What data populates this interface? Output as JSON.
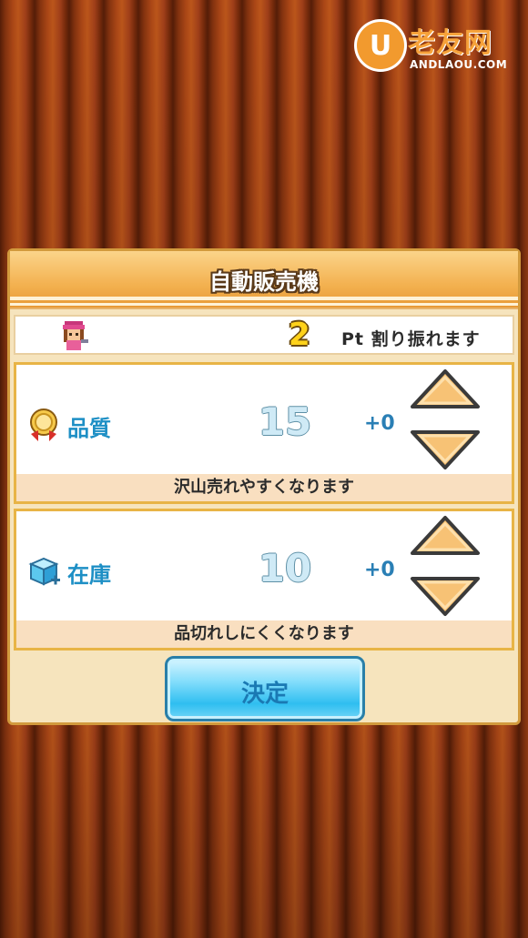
{
  "watermark": {
    "logo_letter": "U",
    "site_name": "老友网",
    "site_url": "ANDLAOU.COM"
  },
  "dialog": {
    "title": "自動販売機",
    "points": {
      "value": "2",
      "label": "Pt 割り振れます"
    },
    "stats": [
      {
        "icon": "gold-medal-icon",
        "label": "品質",
        "value": "15",
        "bonus": "+0",
        "description": "沢山売れやすくなります"
      },
      {
        "icon": "ice-cube-box-icon",
        "label": "在庫",
        "value": "10",
        "bonus": "+0",
        "description": "品切れしにくくなります"
      }
    ],
    "confirm_label": "決定"
  },
  "colors": {
    "curtain": "#a8421a",
    "dialog_bg": "#f6e4bd",
    "header": "#f3b150",
    "stat_label": "#1d8fc5",
    "points_number": "#ffd21a",
    "arrow_fill": "#f7c275",
    "confirm_button": "#2fbef0"
  }
}
